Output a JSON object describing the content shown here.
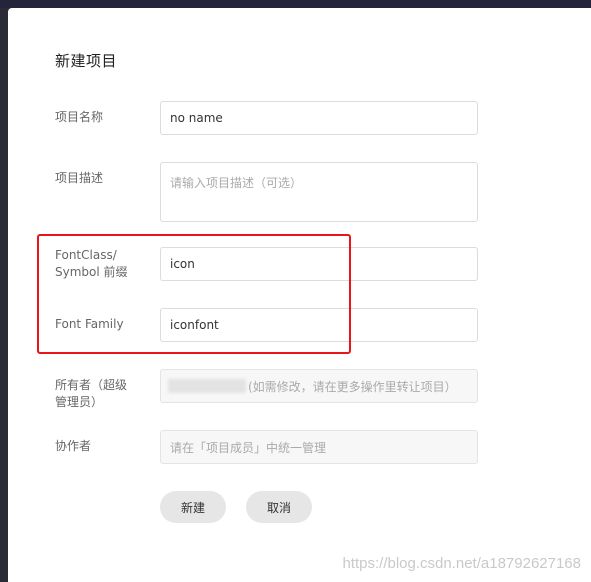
{
  "modal": {
    "title": "新建项目",
    "fields": {
      "name": {
        "label": "项目名称",
        "value": "no name"
      },
      "description": {
        "label": "项目描述",
        "placeholder": "请输入项目描述（可选）"
      },
      "prefix": {
        "label_line1": "FontClass/",
        "label_line2": "Symbol 前缀",
        "value": "icon"
      },
      "font_family": {
        "label": "Font Family",
        "value": "iconfont"
      },
      "owner": {
        "label_line1": "所有者（超级",
        "label_line2": "管理员）",
        "note": "(如需修改，请在更多操作里转让项目）"
      },
      "collaborators": {
        "label": "协作者",
        "placeholder": "请在「项目成员」中统一管理"
      }
    },
    "buttons": {
      "create": "新建",
      "cancel": "取消"
    }
  },
  "watermark": "https://blog.csdn.net/a18792627168",
  "colors": {
    "highlight_border": "#e8151b",
    "button_bg": "#e6e6e6"
  }
}
